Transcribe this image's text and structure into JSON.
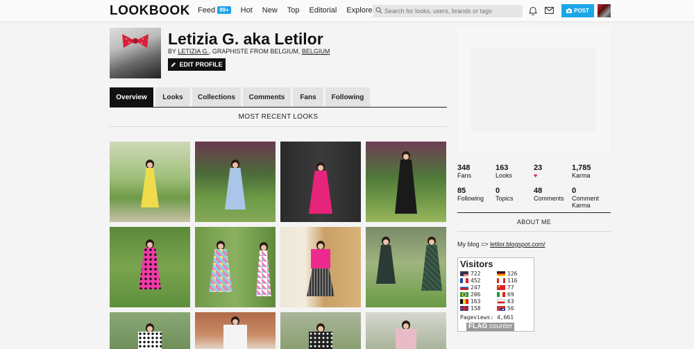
{
  "topbar": {
    "logo": "LOOKBOOK",
    "nav": [
      {
        "label": "Feed",
        "badge": "99+"
      },
      {
        "label": "Hot"
      },
      {
        "label": "New"
      },
      {
        "label": "Top"
      },
      {
        "label": "Editorial"
      },
      {
        "label": "Explore",
        "caret": true
      }
    ],
    "search_placeholder": "Search for looks, users, brands or tags",
    "post_label": "POST"
  },
  "profile": {
    "name": "Letizia G. aka Letilor",
    "by": "BY",
    "author": "LETIZIA G.",
    "role": ", GRAPHISTE FROM BELGIUM, ",
    "country": "BELGIUM",
    "edit_label": "EDIT PROFILE"
  },
  "tabs": [
    "Overview",
    "Looks",
    "Collections",
    "Comments",
    "Fans",
    "Following"
  ],
  "section_title": "MOST RECENT LOOKS",
  "stats": [
    {
      "num": "348",
      "label": "Fans"
    },
    {
      "num": "163",
      "label": "Looks"
    },
    {
      "num": "23",
      "label": "",
      "icon": "heart-icon"
    },
    {
      "num": "1,785",
      "label": "Karma"
    },
    {
      "num": "85",
      "label": "Following"
    },
    {
      "num": "0",
      "label": "Topics"
    },
    {
      "num": "48",
      "label": "Comments"
    },
    {
      "num": "0",
      "label": "Comment Karma"
    }
  ],
  "about_title": "ABOUT ME",
  "blog": {
    "prefix": "My blog => ",
    "link": "letilor.blogspot.com/"
  },
  "flag_counter": {
    "title": "Visitors",
    "rows": [
      {
        "flag": "US",
        "count": "722"
      },
      {
        "flag": "DE",
        "count": "126"
      },
      {
        "flag": "FR",
        "count": "452"
      },
      {
        "flag": "CA",
        "count": "116"
      },
      {
        "flag": "RU",
        "count": "247"
      },
      {
        "flag": "CN",
        "count": "77"
      },
      {
        "flag": "BR",
        "count": "206"
      },
      {
        "flag": "IT",
        "count": "69"
      },
      {
        "flag": "BE",
        "count": "163"
      },
      {
        "flag": "PL",
        "count": "63"
      },
      {
        "flag": "GB",
        "count": "158"
      },
      {
        "flag": "AU",
        "count": "56"
      }
    ],
    "pageviews": "Pageviews: 4,661",
    "brand1": "FLAG",
    "brand2": " counter"
  },
  "colors": {
    "accent": "#1aa6e7",
    "heart": "#e6246e",
    "dark": "#111111"
  }
}
